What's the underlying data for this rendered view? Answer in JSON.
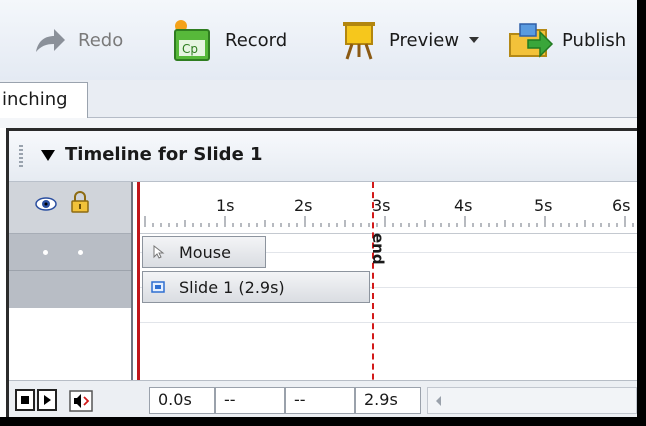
{
  "toolbar": {
    "redo_label": "Redo",
    "record_label": "Record",
    "preview_label": "Preview",
    "publish_label": "Publish",
    "record_icon_text": "Cp"
  },
  "tabs": [
    {
      "label": "inching"
    }
  ],
  "timeline": {
    "title": "Timeline for Slide 1",
    "ruler_ticks": [
      "1s",
      "2s",
      "3s",
      "4s",
      "5s",
      "6s"
    ],
    "tracks": [
      {
        "label": "Mouse",
        "icon": "mouse-pointer-icon"
      },
      {
        "label": "Slide 1 (2.9s)",
        "icon": "slide-icon"
      }
    ],
    "end_marker": "end",
    "controls": {
      "current_time": "0.0s",
      "field2": "--",
      "field3": "--",
      "duration": "2.9s"
    }
  },
  "colors": {
    "playhead": "#c0161b",
    "end_line": "#d21a1a",
    "slide_icon": "#2f6fd1"
  }
}
